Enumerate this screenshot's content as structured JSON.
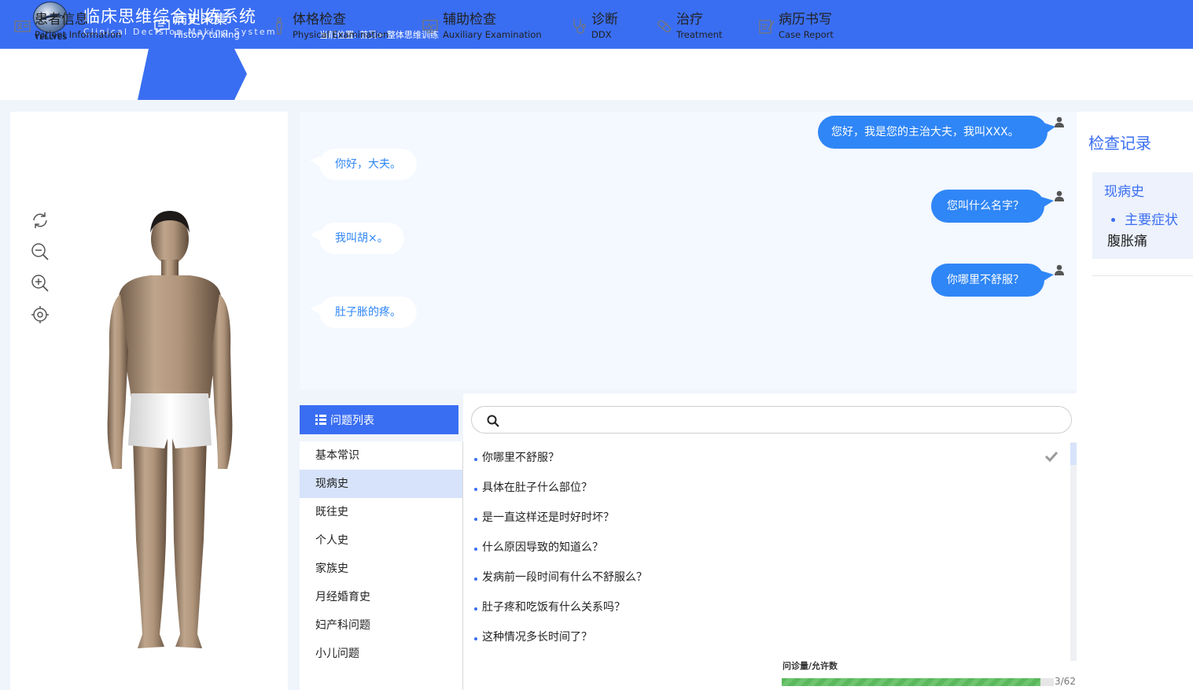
{
  "header": {
    "brand": "TELLYES",
    "title": "临床思维综合训练系统",
    "subtitle": "Clinical Decision Making System",
    "breadcrumb": "当前位置: 首页> 整体思维训练"
  },
  "nav": [
    {
      "zh": "患者信息",
      "en": "Patient Information",
      "icon": "id-card-icon"
    },
    {
      "zh": "病史采集",
      "en": "History talking",
      "icon": "chat-bubble-icon",
      "active": true
    },
    {
      "zh": "体格检查",
      "en": "Physical Examination",
      "icon": "person-icon"
    },
    {
      "zh": "辅助检查",
      "en": "Auxiliary Examination",
      "icon": "monitor-icon"
    },
    {
      "zh": "诊断",
      "en": "DDX",
      "icon": "stethoscope-icon"
    },
    {
      "zh": "治疗",
      "en": "Treatment",
      "icon": "pill-icon"
    },
    {
      "zh": "病历书写",
      "en": "Case Report",
      "icon": "document-edit-icon"
    }
  ],
  "tools": [
    "rotate-icon",
    "zoom-out-icon",
    "zoom-in-icon",
    "locate-icon"
  ],
  "chat": [
    {
      "side": "doctor",
      "text": "您好，我是您的主治大夫，我叫XXX。"
    },
    {
      "side": "patient",
      "text": "你好，大夫。"
    },
    {
      "side": "doctor",
      "text": "您叫什么名字？"
    },
    {
      "side": "patient",
      "text": "我叫胡×。"
    },
    {
      "side": "doctor",
      "text": "你哪里不舒服？"
    },
    {
      "side": "patient",
      "text": "肚子胀的疼。"
    }
  ],
  "question_list": {
    "title": "问题列表",
    "categories": [
      "基本常识",
      "现病史",
      "既往史",
      "个人史",
      "家族史",
      "月经婚育史",
      "妇产科问题",
      "小儿问题"
    ],
    "active_category": "现病史",
    "search_placeholder": "",
    "questions": [
      {
        "text": "你哪里不舒服？",
        "asked": true
      },
      {
        "text": "具体在肚子什么部位？",
        "asked": false
      },
      {
        "text": "是一直这样还是时好时坏？",
        "asked": false
      },
      {
        "text": "什么原因导致的知道么？",
        "asked": false
      },
      {
        "text": "发病前一段时间有什么不舒服么？",
        "asked": false
      },
      {
        "text": "肚子疼和吃饭有什么关系吗？",
        "asked": false
      },
      {
        "text": "这种情况多长时间了？",
        "asked": false
      }
    ]
  },
  "quota": {
    "label": "问诊量/允许数",
    "value_text": "3/62",
    "fraction": 0.95
  },
  "records": {
    "title": "检查记录",
    "section": "现病史",
    "item": "主要症状",
    "value": "腹胀痛"
  },
  "colors": {
    "primary": "#3a6ef2",
    "bubble": "#2f86f6",
    "progress": "#5cb85c"
  }
}
